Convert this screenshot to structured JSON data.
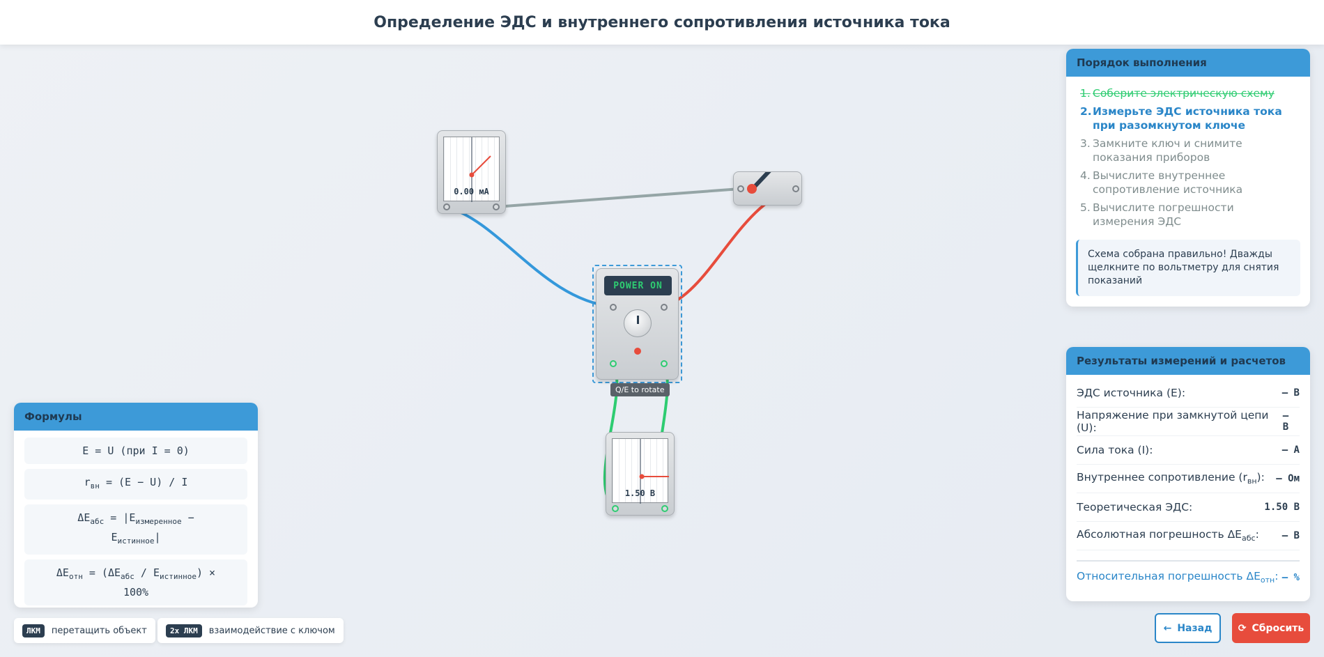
{
  "header": {
    "title": "Определение ЭДС и внутреннего сопротивления источника тока"
  },
  "steps": {
    "title": "Порядок выполнения",
    "items": [
      {
        "num": "1.",
        "text": "Соберите электрическую схему",
        "state": "done"
      },
      {
        "num": "2.",
        "text": "Измерьте ЭДС источника тока при разомкнутом ключе",
        "state": "active"
      },
      {
        "num": "3.",
        "text": "Замкните ключ и снимите показания приборов",
        "state": "pending"
      },
      {
        "num": "4.",
        "text": "Вычислите внутреннее сопротивление источника",
        "state": "pending"
      },
      {
        "num": "5.",
        "text": "Вычислите погрешности измерения ЭДС",
        "state": "pending"
      }
    ],
    "hint": "Схема собрана правильно! Дважды щелкните по вольтметру для снятия показаний"
  },
  "results": {
    "title": "Результаты измерений и расчетов",
    "rows": [
      {
        "label": "ЭДС источника (E):",
        "value": "– В"
      },
      {
        "label": "Напряжение при замкнутой цепи (U):",
        "value": "– В"
      },
      {
        "label": "Сила тока (I):",
        "value": "– А"
      },
      {
        "label_main": "Внутреннее сопротивление (r",
        "label_sub": "вн",
        "label_end": "):",
        "value": "– Ом"
      },
      {
        "label": "Теоретическая ЭДС:",
        "value": "1.50 В"
      },
      {
        "label_main": "Абсолютная погрешность ΔE",
        "label_sub": "абс",
        "label_end": ":",
        "value": "– В"
      }
    ],
    "relative": {
      "label_main": "Относительная погрешность ΔE",
      "label_sub": "отн",
      "label_end": ":",
      "value": "– %"
    }
  },
  "formulas": {
    "title": "Формулы",
    "f1": "E = U (при I = 0)",
    "f2": {
      "a": "r",
      "a_sub": "вн",
      "b": " = (E − U) / I"
    },
    "f3": {
      "a": "ΔE",
      "a_sub": "абс",
      "b": " = |E",
      "b_sub": "измеренное",
      "c": " −",
      "d": "E",
      "d_sub": "истинное",
      "e": "|"
    },
    "f4": {
      "a": "ΔE",
      "a_sub": "отн",
      "b": " = (ΔE",
      "b_sub": "абс",
      "c": " / E",
      "c_sub": "истинное",
      "d": ") ×",
      "e": "100%"
    }
  },
  "chips": [
    {
      "key": "ЛКМ",
      "text": "перетащить объект"
    },
    {
      "key": "2x ЛКМ",
      "text": "взаимодействие с ключом"
    }
  ],
  "buttons": {
    "back": "Назад",
    "reset": "Сбросить"
  },
  "devices": {
    "ammeter_reading": "0.00 мА",
    "voltmeter_reading": "1.50 В",
    "source_display": "POWER ON",
    "tooltip": "Q/E to rotate"
  },
  "colors": {
    "accent": "#3d9ad8",
    "done": "#2ecc71",
    "reset": "#e74c3c",
    "wire_blue": "#3498db",
    "wire_red": "#e74c3c",
    "wire_green": "#2ecc71",
    "wire_gray": "#95a5a6"
  }
}
